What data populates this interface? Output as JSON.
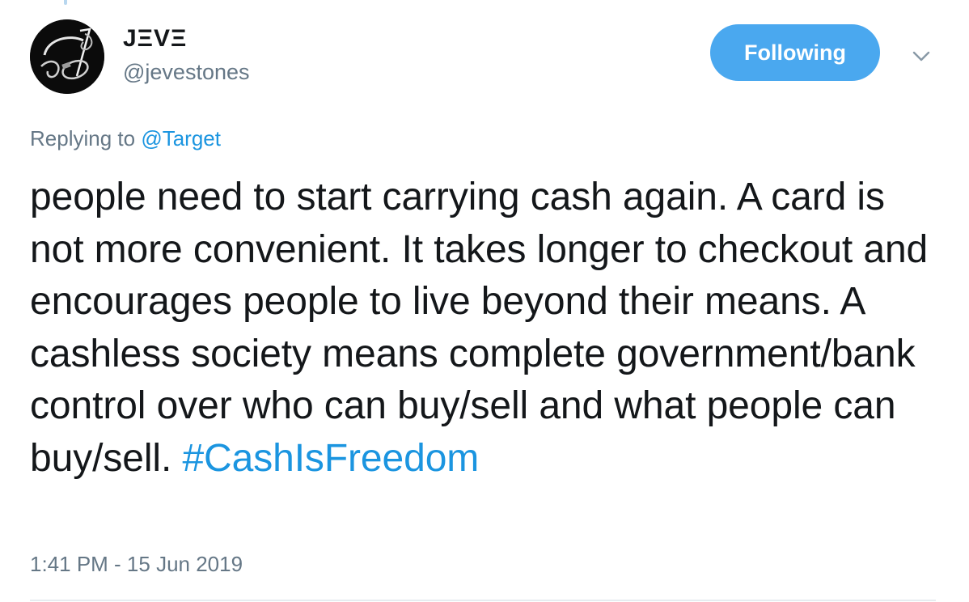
{
  "author": {
    "display_name": "JΞVΞ",
    "handle": "@jevestones",
    "avatar_icon": "guitar-logo-avatar"
  },
  "follow_button": {
    "label": "Following",
    "color": "#4aa8ef"
  },
  "menu_caret_icon": "chevron-down-icon",
  "reply_context": {
    "prefix": "Replying to",
    "mention": "@Target"
  },
  "tweet": {
    "body": "people need to start carrying cash again. A card is not more convenient. It takes longer to checkout and encourages people to live beyond their means. A cashless society means complete government/bank control over who can buy/sell and what people can buy/sell.",
    "hashtag": "#CashIsFreedom",
    "timestamp": "1:41 PM - 15 Jun 2019"
  },
  "colors": {
    "text": "#14171a",
    "secondary": "#657786",
    "link": "#1b95e0",
    "divider": "#e6ecf0"
  }
}
